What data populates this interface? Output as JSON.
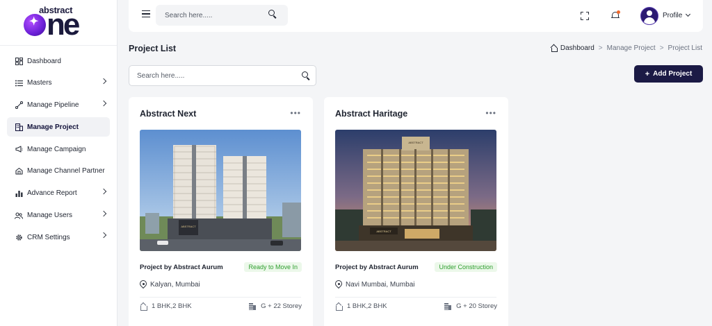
{
  "brand": {
    "top": "abstract",
    "bottom": "one"
  },
  "sidebar": {
    "items": [
      {
        "label": "Dashboard",
        "icon": "dashboard-icon",
        "chevron": false,
        "active": false
      },
      {
        "label": "Masters",
        "icon": "list-icon",
        "chevron": true,
        "active": false
      },
      {
        "label": "Manage Pipeline",
        "icon": "pipeline-icon",
        "chevron": true,
        "active": false
      },
      {
        "label": "Manage Project",
        "icon": "building-icon",
        "chevron": false,
        "active": true
      },
      {
        "label": "Manage Campaign",
        "icon": "megaphone-icon",
        "chevron": false,
        "active": false
      },
      {
        "label": "Manage Channel Partner",
        "icon": "partner-icon",
        "chevron": false,
        "active": false
      },
      {
        "label": "Advance Report",
        "icon": "bar-chart-icon",
        "chevron": true,
        "active": false
      },
      {
        "label": "Manage Users",
        "icon": "users-icon",
        "chevron": true,
        "active": false
      },
      {
        "label": "CRM Settings",
        "icon": "gear-icon",
        "chevron": true,
        "active": false
      }
    ]
  },
  "topbar": {
    "search_placeholder": "Search here.....",
    "profile_label": "Profile"
  },
  "page": {
    "title": "Project List",
    "breadcrumb": [
      "Dashboard",
      "Manage Project",
      "Project List"
    ],
    "search_placeholder": "Search here.....",
    "add_button_label": "Add Project"
  },
  "projects": [
    {
      "title": "Abstract Next",
      "developer": "Project by Abstract Aurum",
      "status": "Ready to Move In",
      "location": "Kalyan, Mumbai",
      "bhk": "1 BHK,2 BHK",
      "storey": "G + 22 Storey"
    },
    {
      "title": "Abstract Haritage",
      "developer": "Project by Abstract Aurum",
      "status": "Under Construction",
      "location": "Navi Mumbai, Mumbai",
      "bhk": "1 BHK,2 BHK",
      "storey": "G + 20 Storey"
    }
  ],
  "colors": {
    "accent": "#1b1a45",
    "status_bg": "#ecf8ea",
    "status_text": "#2e9e2e",
    "notification_dot": "#f36a2d"
  }
}
